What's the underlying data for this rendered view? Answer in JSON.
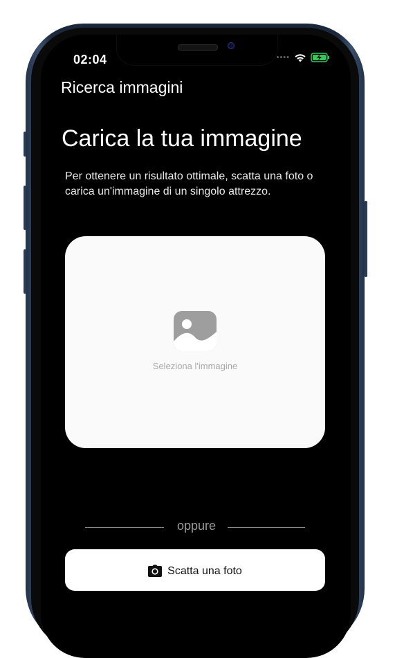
{
  "status_bar": {
    "time": "02:04"
  },
  "nav": {
    "title": "Ricerca immagini"
  },
  "main": {
    "headline": "Carica la tua immagine",
    "description": "Per ottenere un risultato ottimale, scatta una foto o carica un'immagine di un singolo attrezzo.",
    "upload": {
      "label": "Seleziona l'immagine",
      "icon": "image-icon"
    },
    "divider": {
      "text": "oppure"
    },
    "photo_button": {
      "label": "Scatta una foto",
      "icon": "camera-icon"
    }
  },
  "colors": {
    "screen_background": "#000000",
    "card_background": "#fafafa",
    "battery_green": "#34c759",
    "muted_text": "#a8a8a8"
  }
}
